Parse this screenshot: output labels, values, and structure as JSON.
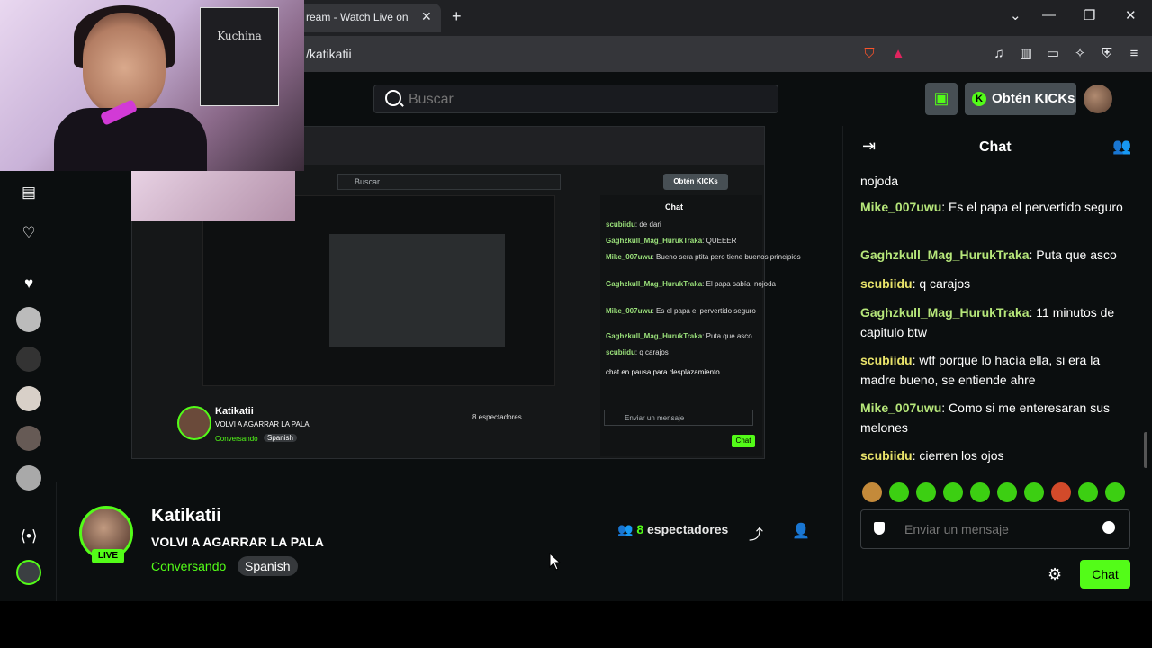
{
  "browser": {
    "tab_title": "ream - Watch Live on",
    "url": "/katikatii",
    "new_tab_icon": "+",
    "close_tab_icon": "✕"
  },
  "kick": {
    "search_placeholder": "Buscar",
    "kicks_button": "Obtén KICKs",
    "kicks_logo": "K"
  },
  "mini_stream": {
    "search": "Buscar",
    "kicks": "Obtén KICKs",
    "chat_title": "Chat",
    "chat_lines": [
      {
        "user": "scubiidu",
        "text": "de dari"
      },
      {
        "user": "Gaghzkull_Mag_HurukTraka",
        "text": "QUEEER"
      },
      {
        "user": "Mike_007uwu",
        "text": "Bueno sera ptita pero tiene buenos principios"
      },
      {
        "user": "Gaghzkull_Mag_HurukTraka",
        "text": "El papa sabía, nojoda"
      },
      {
        "user": "Mike_007uwu",
        "text": "Es el papa el pervertido seguro"
      },
      {
        "user": "Gaghzkull_Mag_HurukTraka",
        "text": "Puta que asco"
      },
      {
        "user": "scubiidu",
        "text": "q carajos"
      }
    ],
    "paused": "chat en pausa para desplazamiento",
    "send_placeholder": "Enviar un mensaje",
    "chat_button": "Chat",
    "name": "Katikatii",
    "title": "VOLVI A AGARRAR LA PALA",
    "category": "Conversando",
    "language": "Spanish",
    "viewers": "8 espectadores"
  },
  "stream": {
    "streamer": "Katikatii",
    "title": "VOLVI A AGARRAR LA PALA",
    "category": "Conversando",
    "language": "Spanish",
    "live": "LIVE",
    "viewer_count": "8",
    "viewer_label": "espectadores"
  },
  "chat": {
    "title": "Chat",
    "messages": [
      {
        "user": "",
        "text": "nojoda",
        "color": "#ffffff"
      },
      {
        "user": "Mike_007uwu",
        "text": "Es el papa el pervertido seguro",
        "color": "#b6e67a"
      },
      {
        "user": "Gaghzkull_Mag_HurukTraka",
        "text": "Puta que asco",
        "color": "#b6e67a"
      },
      {
        "user": "scubiidu",
        "text": "q carajos",
        "color": "#e9e36a"
      },
      {
        "user": "Gaghzkull_Mag_HurukTraka",
        "text": "11 minutos de capitulo btw",
        "color": "#b6e67a"
      },
      {
        "user": "scubiidu",
        "text": "wtf porque lo hacía ella, si era la madre bueno, se entiende ahre",
        "color": "#e9e36a"
      },
      {
        "user": "Mike_007uwu",
        "text": "Como si me enteresaran sus melones",
        "color": "#b6e67a"
      },
      {
        "user": "scubiidu",
        "text": "cierren los ojos",
        "color": "#e9e36a"
      }
    ],
    "send_placeholder": "Enviar un mensaje",
    "send_button": "Chat"
  },
  "webcam": {
    "poster_text": "Kuchina"
  },
  "colors": {
    "accent": "#53fc18",
    "background": "#0b0e0f"
  }
}
